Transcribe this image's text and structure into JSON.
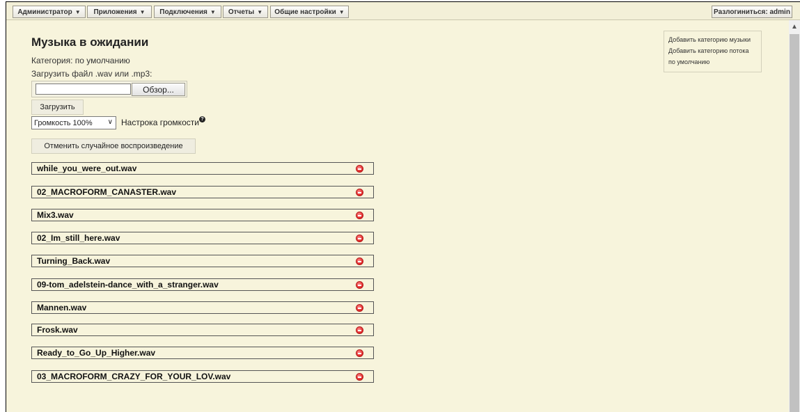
{
  "menu": {
    "items": [
      {
        "label": "Администратор"
      },
      {
        "label": "Приложения"
      },
      {
        "label": "Подключения"
      },
      {
        "label": "Отчеты"
      },
      {
        "label": "Общие настройки"
      }
    ],
    "caret": "▼",
    "logout_label": "Разлогиниться: admin"
  },
  "page": {
    "title": "Музыка в ожидании",
    "category_line": "Категория: по умолчанию",
    "upload_label": "Загрузить файл .wav или .mp3:",
    "browse_label": "Обзор...",
    "file_input_value": "",
    "upload_button": "Загрузить",
    "volume_selected": "Громкость 100%",
    "volume_label": "Настрока громкости",
    "help_glyph": "?",
    "shuffle_button": "Отменить случайное воспроизведение"
  },
  "side_panel": {
    "links": [
      "Добавить категорию музыки",
      "Добавить категорию потока",
      "по умолчанию"
    ]
  },
  "files": [
    "while_you_were_out.wav",
    "02_MACROFORM_CANASTER.wav",
    "Mix3.wav",
    "02_Im_still_here.wav",
    "Turning_Back.wav",
    "09-tom_adelstein-dance_with_a_stranger.wav",
    "Mannen.wav",
    "Frosk.wav",
    "Ready_to_Go_Up_Higher.wav",
    "03_MACROFORM_CRAZY_FOR_YOUR_LOV.wav"
  ],
  "colors": {
    "background": "#f7f4dc",
    "delete": "#e02424"
  },
  "icons": {
    "delete": "delete-icon",
    "help": "help-icon",
    "dropdown": "chevron-down-icon"
  }
}
